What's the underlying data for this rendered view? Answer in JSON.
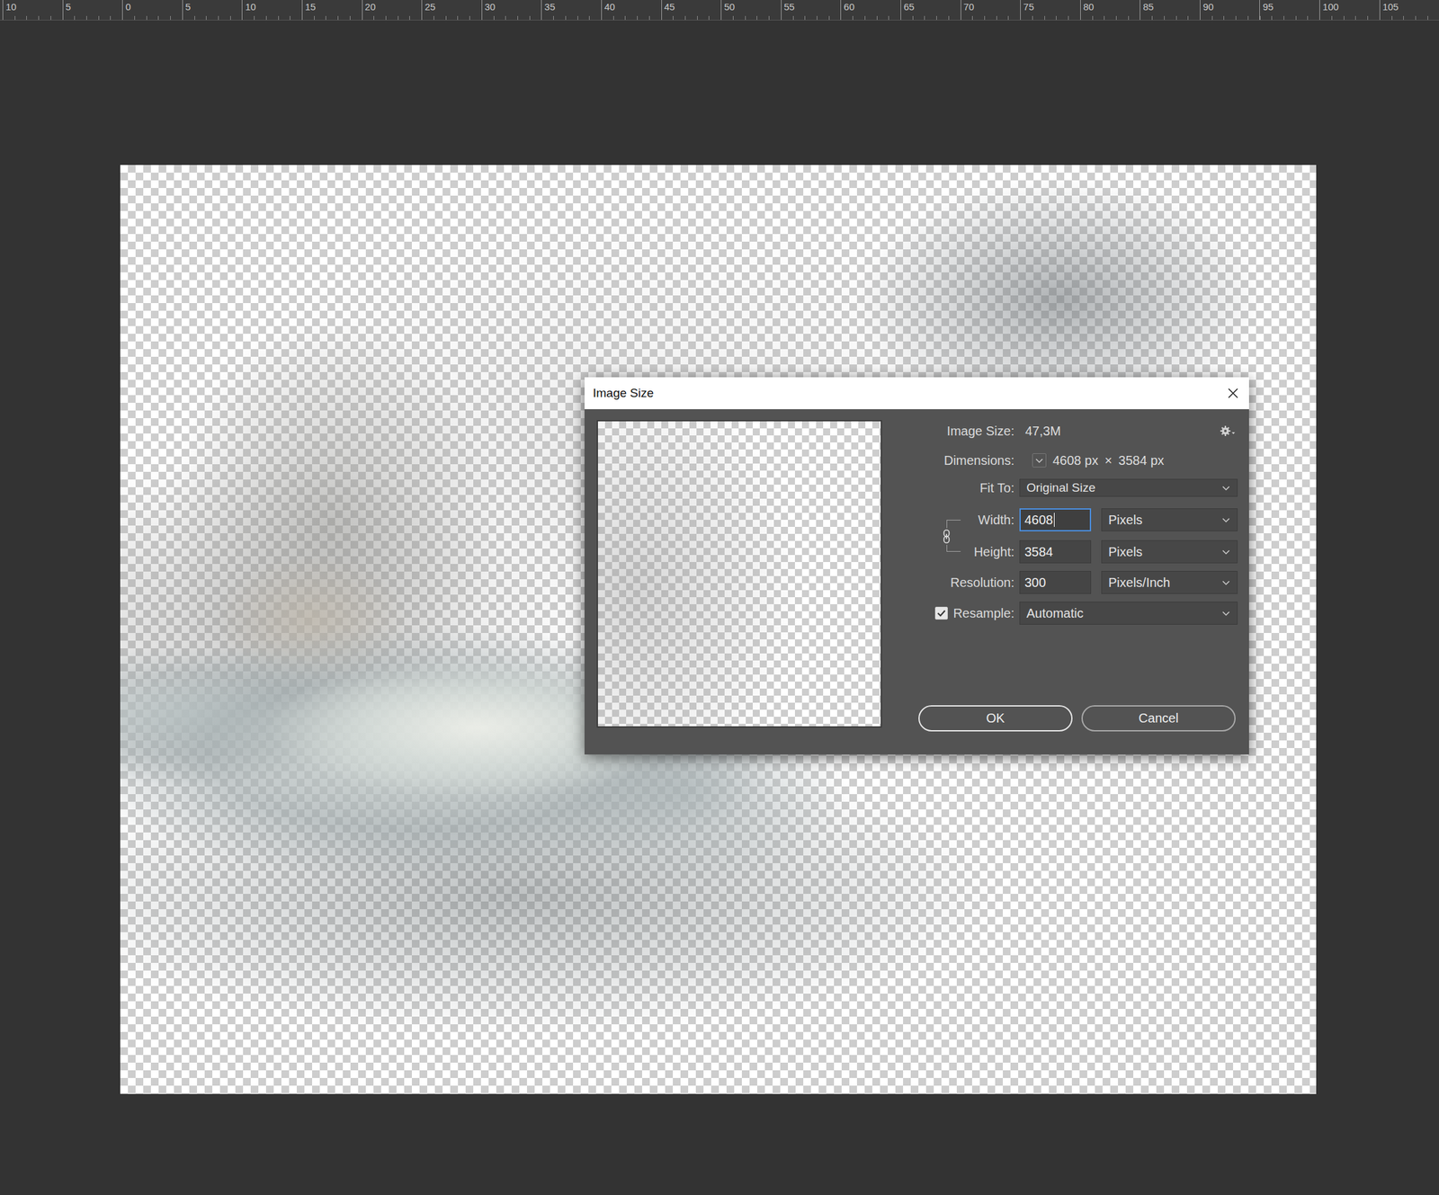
{
  "ruler": {
    "ticks": [
      "10",
      "5",
      "0",
      "5",
      "10",
      "15",
      "20",
      "25",
      "30",
      "35",
      "40",
      "45",
      "50",
      "55",
      "60",
      "65",
      "70",
      "75",
      "80",
      "85",
      "90",
      "95",
      "100",
      "105"
    ]
  },
  "dialog": {
    "title": "Image Size"
  },
  "image_size": {
    "label": "Image Size:",
    "value": "47,3M"
  },
  "dimensions": {
    "label": "Dimensions:",
    "width": "4608 px",
    "times": "×",
    "height": "3584 px"
  },
  "fit_to": {
    "label": "Fit To:",
    "value": "Original Size"
  },
  "constrain": {
    "linked": true
  },
  "width": {
    "label": "Width:",
    "value": "4608",
    "unit": "Pixels",
    "focused": true
  },
  "height": {
    "label": "Height:",
    "value": "3584",
    "unit": "Pixels",
    "focused": false
  },
  "resolution": {
    "label": "Resolution:",
    "value": "300",
    "unit": "Pixels/Inch",
    "focused": false
  },
  "resample": {
    "label": "Resample:",
    "checked": true,
    "value": "Automatic"
  },
  "buttons": [
    {
      "label": "OK",
      "default": true
    },
    {
      "label": "Cancel",
      "default": false
    }
  ]
}
